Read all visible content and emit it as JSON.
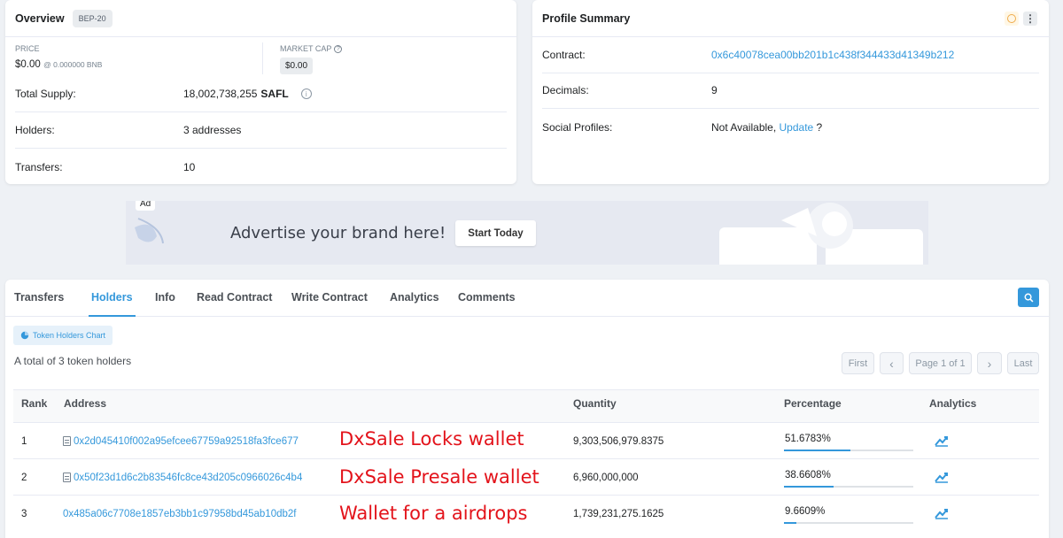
{
  "overview": {
    "title": "Overview",
    "tag": "BEP-20",
    "price_label": "PRICE",
    "price_value": "$0.00",
    "price_bnb": "@ 0.000000 BNB",
    "mcap_label": "MARKET CAP",
    "mcap_value": "$0.00",
    "rows": [
      {
        "label": "Total Supply:",
        "value": "18,002,738,255",
        "unit": "SAFL"
      },
      {
        "label": "Holders:",
        "value": "3 addresses"
      },
      {
        "label": "Transfers:",
        "value": "10"
      }
    ]
  },
  "profile": {
    "title": "Profile Summary",
    "rows": [
      {
        "label": "Contract:",
        "value": "0x6c40078cea00bb201b1c438f344433d41349b212"
      },
      {
        "label": "Decimals:",
        "value": "9"
      },
      {
        "label": "Social Profiles:",
        "value": "Not Available, ",
        "link": "Update",
        "suffix": " ?"
      }
    ]
  },
  "ad": {
    "badge": "Ad",
    "headline": "Advertise your brand here!",
    "button": "Start Today"
  },
  "tabs": [
    "Transfers",
    "Holders",
    "Info",
    "Read Contract",
    "Write Contract",
    "Analytics",
    "Comments"
  ],
  "active_tab": "Holders",
  "holders": {
    "chart_button": "Token Holders Chart",
    "total_text": "A total of 3 token holders",
    "pagination": {
      "first": "First",
      "prev": "‹",
      "page": "Page 1 of 1",
      "next": "›",
      "last": "Last"
    },
    "columns": [
      "Rank",
      "Address",
      "Quantity",
      "Percentage",
      "Analytics"
    ],
    "rows": [
      {
        "rank": "1",
        "address": "0x2d045410f002a95efcee67759a92518fa3fce677",
        "contract": true,
        "note": "DxSale Locks wallet",
        "quantity": "9,303,506,979.8375",
        "percentage": "51.6783%",
        "pct": 0.516783
      },
      {
        "rank": "2",
        "address": "0x50f23d1d6c2b83546fc8ce43d205c0966026c4b4",
        "contract": true,
        "note": "DxSale Presale wallet",
        "quantity": "6,960,000,000",
        "percentage": "38.6608%",
        "pct": 0.386608
      },
      {
        "rank": "3",
        "address": "0x485a06c7708e1857eb3bb1c97958bd45ab10db2f",
        "contract": false,
        "note": "Wallet for a airdrops",
        "quantity": "1,739,231,275.1625",
        "percentage": "9.6609%",
        "pct": 0.096609
      }
    ]
  },
  "colors": {
    "accent": "#3498db",
    "annotation": "#e3131b",
    "warning": "#f0ad4e"
  }
}
